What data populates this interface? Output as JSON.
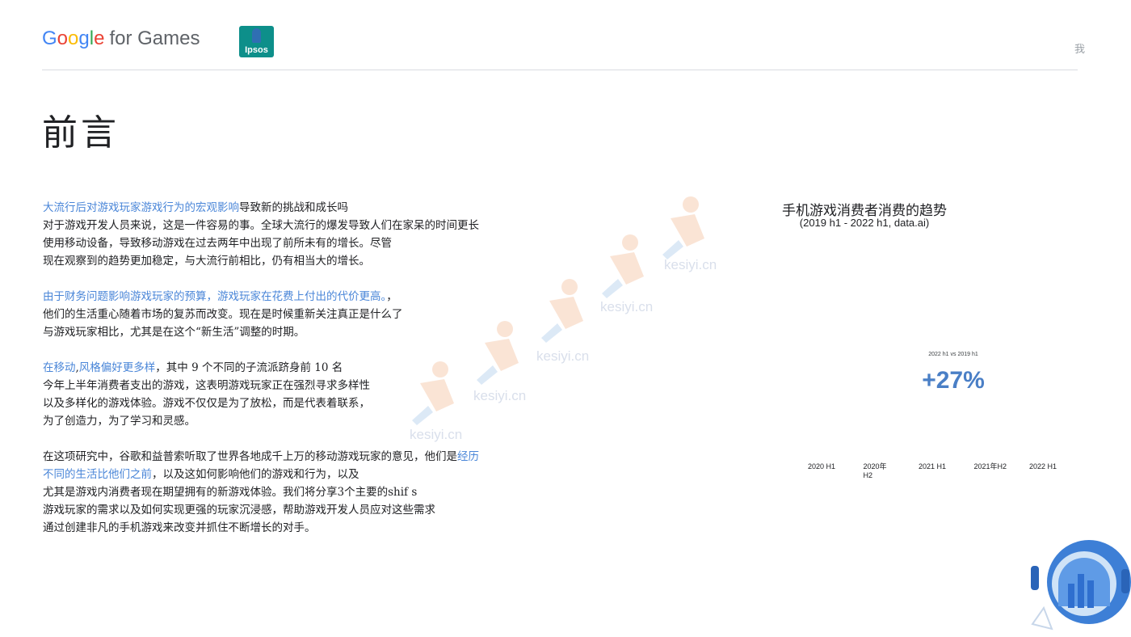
{
  "header": {
    "brand_google": [
      "G",
      "o",
      "o",
      "g",
      "l",
      "e"
    ],
    "brand_rest": "for Games",
    "partner_logo": "Ipsos",
    "corner_glyph": "我"
  },
  "page": {
    "title": "前言"
  },
  "paragraphs": [
    [
      [
        {
          "t": "大流行后对游戏玩家游戏行为的宏观影响",
          "hl": true
        },
        {
          "t": "导致新的挑战和成长吗",
          "hl": false
        }
      ],
      [
        {
          "t": "对于游戏开发人员来说，这是一件容易的事。全球大流行的爆发导致人们在家呆的时间更长",
          "hl": false
        }
      ],
      [
        {
          "t": "使用移动设备，导致移动游戏在过去两年中出现了前所未有的增长。尽管",
          "hl": false
        }
      ],
      [
        {
          "t": "现在观察到的趋势更加稳定，与大流行前相比，仍有相当大的增长。",
          "hl": false
        }
      ]
    ],
    [
      [
        {
          "t": "由于财务问题影响游戏玩家的预算，游戏玩家在花费上付出的代价更高。",
          "hl": true
        },
        {
          "t": "，",
          "hl": false
        }
      ],
      [
        {
          "t": "他们的生活重心随着市场的复苏而改变。现在是时候重新关注真正是什么了",
          "hl": false
        }
      ],
      [
        {
          "t": "与游戏玩家相比，尤其是在这个“新生活”调整的时期。",
          "hl": false
        }
      ]
    ],
    [
      [
        {
          "t": "在移动",
          "hl": true
        },
        {
          "t": ",",
          "hl": false
        },
        {
          "t": "风格偏好更多样",
          "hl": true
        },
        {
          "t": "，其中 9 个不同的子流派跻身前 10 名",
          "hl": false
        }
      ],
      [
        {
          "t": "今年上半年消费者支出的游戏，这表明游戏玩家正在强烈寻求多样性",
          "hl": false
        }
      ],
      [
        {
          "t": "以及多样化的游戏体验。游戏不仅仅是为了放松，而是代表着联系，",
          "hl": false
        }
      ],
      [
        {
          "t": "为了创造力，为了学习和灵感。",
          "hl": false
        }
      ]
    ],
    [
      [
        {
          "t": "在这项研究中，谷歌和益普索听取了世界各地成千上万的移动游戏玩家的意见，他们是",
          "hl": false
        },
        {
          "t": "经历",
          "hl": true
        }
      ],
      [
        {
          "t": "不同的生活比他们之前",
          "hl": true
        },
        {
          "t": "，以及这如何影响他们的游戏和行为，以及",
          "hl": false
        }
      ],
      [
        {
          "t": "尤其是游戏内消费者现在期望拥有的新游戏体验。我们将分享3个主要的shif s",
          "hl": false
        }
      ],
      [
        {
          "t": "游戏玩家的需求以及如何实现更强的玩家沉浸感，帮助游戏开发人员应对这些需求",
          "hl": false
        }
      ],
      [
        {
          "t": "通过创建非凡的手机游戏来改变并抓住不断增长的对手。",
          "hl": false
        }
      ]
    ]
  ],
  "watermark": {
    "text": "kesiyi.cn"
  },
  "chart_data": {
    "type": "bar",
    "title": "手机游戏消费者消费的趋势",
    "subtitle": "(2019 h1 - 2022 h1, data.ai)",
    "categories": [
      "2020 H1",
      "2020年\nH2",
      "2021 H1",
      "2021年H2",
      "2022 H1"
    ],
    "values": [],
    "annotation": {
      "label": "2022 h1 vs 2019 h1",
      "value": "+27%"
    },
    "accent_color": "#4a7fc6",
    "grid": false
  },
  "colors": {
    "highlight": "#4a86d8",
    "accent": "#4a7fc6",
    "divider": "#dadce0"
  }
}
